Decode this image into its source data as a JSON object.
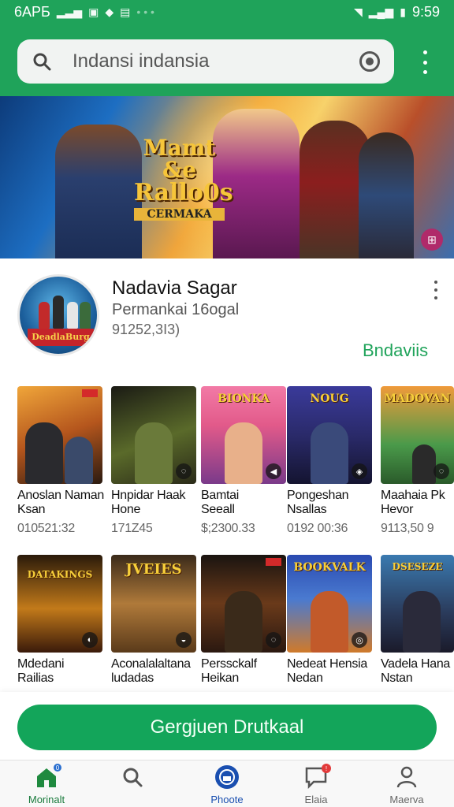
{
  "status_bar": {
    "left_text": "6APБ",
    "time": "9:59"
  },
  "search": {
    "value": "Indansi indansia",
    "placeholder": "Indansi indansia"
  },
  "banner": {
    "logo_line1": "Mamt &e",
    "logo_line2": "Rallo0s",
    "logo_line3": "CERMAKA"
  },
  "app": {
    "name": "Nadavia Sagar",
    "developer": "Permankai 16ogal",
    "meta": "91252,3I3)",
    "link": "Bndaviis",
    "icon_banner": "DeadlaBurg"
  },
  "grid": {
    "row1": [
      {
        "title1": "Anoslan Naman",
        "title2": "Ksan",
        "meta": "010521:32",
        "art": ""
      },
      {
        "title1": "Hnpidar Haak",
        "title2": "Hone",
        "meta": "171Z45",
        "art": ""
      },
      {
        "title1": "Bamtai",
        "title2": "Seeall",
        "meta": "$;2300.33",
        "art": "BIONKA"
      },
      {
        "title1": "Pongeshan",
        "title2": "Nsallas",
        "meta": "0192 00:36",
        "art": "NOUG"
      },
      {
        "title1": "Maahaia Pk",
        "title2": "Hevor",
        "meta": "9113,50 9",
        "art": "MADOVAN"
      }
    ],
    "row2": [
      {
        "title1": "Mdedani",
        "title2": "Railias",
        "art": "DATAKINGS"
      },
      {
        "title1": "Aconalalaltana",
        "title2": "ludadas",
        "art": "JVEIES"
      },
      {
        "title1": "Perssckalf",
        "title2": "Heikan",
        "art": ""
      },
      {
        "title1": "Nedeat Hensia",
        "title2": "Nedan",
        "art": "BOOKVALK"
      },
      {
        "title1": "Vadela Hana",
        "title2": "Nstan",
        "art": "DSESEZE"
      }
    ]
  },
  "install_button": "Gergjuen Drutkaal",
  "nav": {
    "items": [
      {
        "label": "Morinalt",
        "icon": "home-icon"
      },
      {
        "label": "",
        "icon": "search-icon"
      },
      {
        "label": "Phoote",
        "icon": "camera-icon"
      },
      {
        "label": "Elaia",
        "icon": "chat-icon"
      },
      {
        "label": "Maerva",
        "icon": "profile-icon"
      }
    ]
  },
  "colors": {
    "brand_green": "#1fa35a",
    "install_green": "#13a55a",
    "text": "#111111"
  }
}
